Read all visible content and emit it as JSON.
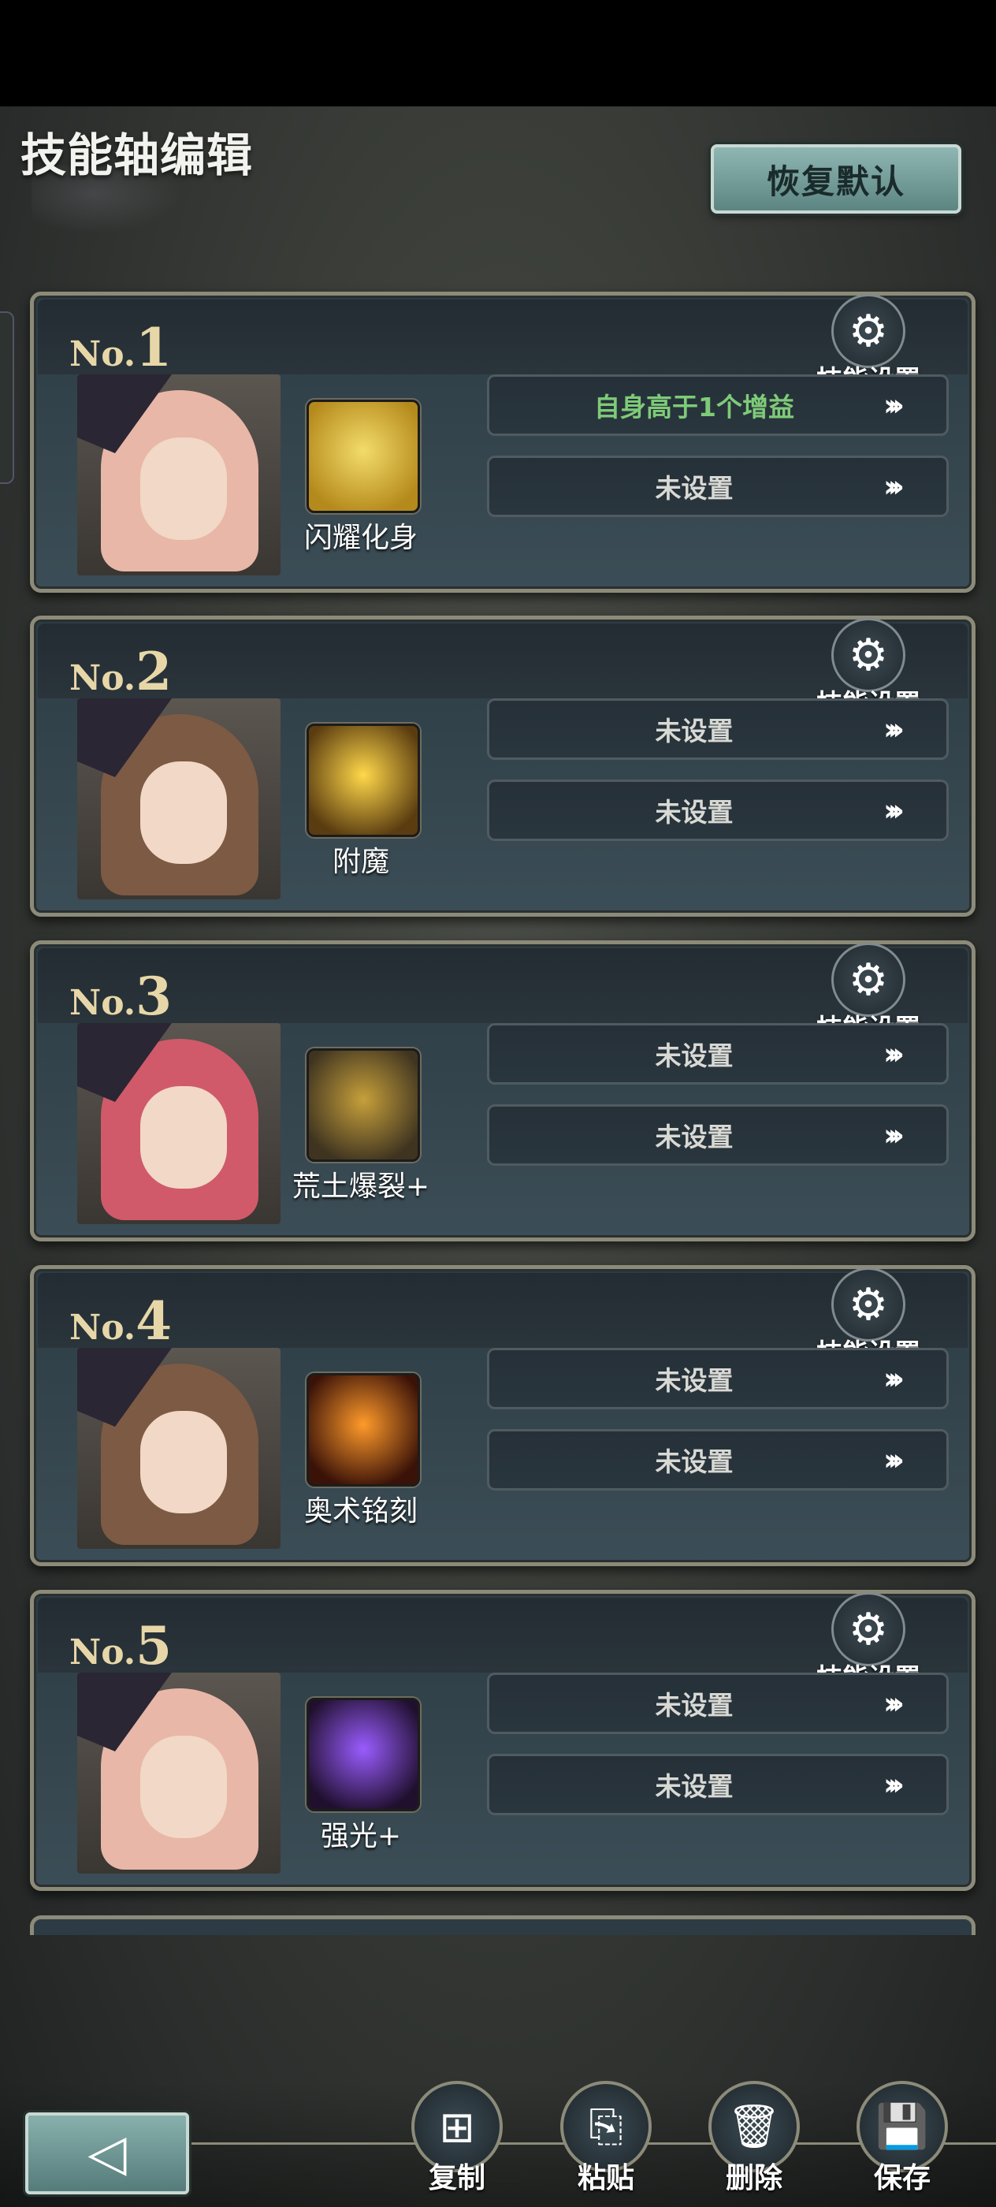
{
  "header": {
    "title": "技能轴编辑",
    "reset_label": "恢复默认"
  },
  "gear_label": "技能设置",
  "cards": [
    {
      "num_prefix": "No.",
      "num": "1",
      "skill": "闪耀化身",
      "cond1": "自身高于1个增益",
      "cond2": "未设置",
      "icon_colors": [
        "#f3dc6a",
        "#b58a1c"
      ],
      "hair": "#e8b7a8"
    },
    {
      "num_prefix": "No.",
      "num": "2",
      "skill": "附魔",
      "cond1": "未设置",
      "cond2": "未设置",
      "icon_colors": [
        "#ffd84a",
        "#5a3c10"
      ],
      "hair": "#7d5a44"
    },
    {
      "num_prefix": "No.",
      "num": "3",
      "skill": "荒土爆裂+",
      "cond1": "未设置",
      "cond2": "未设置",
      "icon_colors": [
        "#c7a03b",
        "#3f3420"
      ],
      "hair": "#d05a6a"
    },
    {
      "num_prefix": "No.",
      "num": "4",
      "skill": "奥术铭刻",
      "cond1": "未设置",
      "cond2": "未设置",
      "icon_colors": [
        "#ff9a2a",
        "#3a1208"
      ],
      "hair": "#7d5a44"
    },
    {
      "num_prefix": "No.",
      "num": "5",
      "skill": "强光+",
      "cond1": "未设置",
      "cond2": "未设置",
      "icon_colors": [
        "#9a5cff",
        "#20102e"
      ],
      "hair": "#e8b7a8"
    }
  ],
  "arrow_glyph": "›››",
  "gear_glyph": "⚙",
  "actions": {
    "copy": {
      "label": "复制",
      "glyph": "⊞"
    },
    "paste": {
      "label": "粘贴",
      "glyph": "⎘"
    },
    "delete": {
      "label": "删除",
      "glyph": "🗑"
    },
    "save": {
      "label": "保存",
      "glyph": "💾"
    }
  },
  "back_glyph": "◁",
  "colors": {
    "accent": "#8fb6b3",
    "gold": "#e7d7a8",
    "green_text": "#7ecb78"
  }
}
